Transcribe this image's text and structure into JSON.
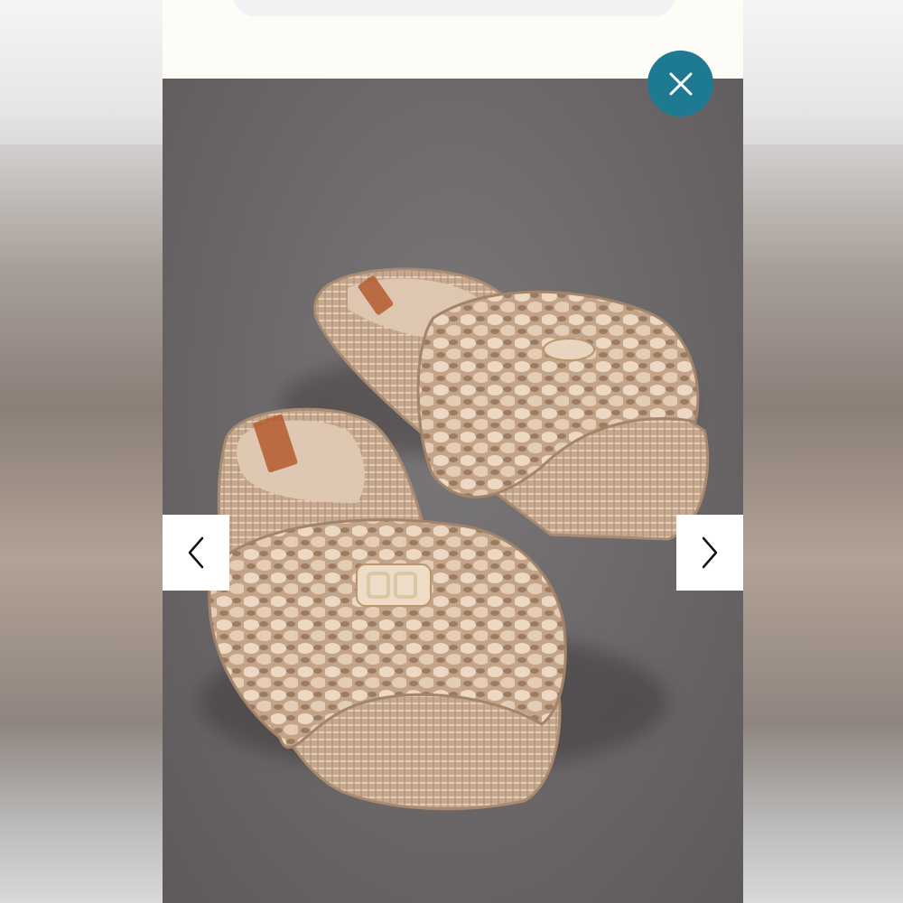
{
  "gallery": {
    "image_alt": "",
    "accent_color": "#1e7a90",
    "icons": {
      "close": "close-icon",
      "previous": "chevron-left-icon",
      "next": "chevron-right-icon"
    }
  }
}
